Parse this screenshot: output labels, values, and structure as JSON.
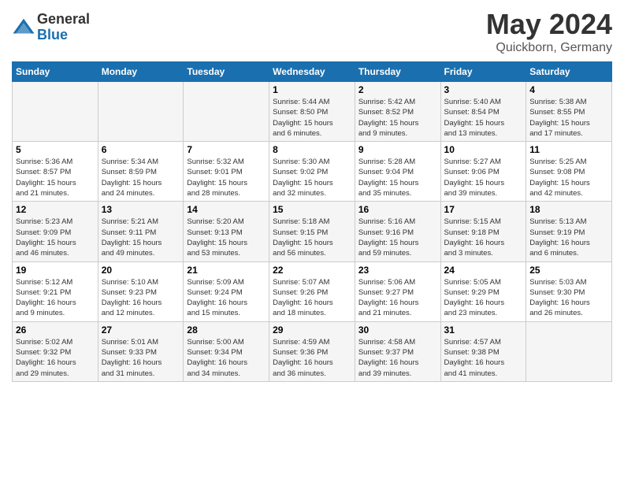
{
  "header": {
    "logo_general": "General",
    "logo_blue": "Blue",
    "month": "May 2024",
    "location": "Quickborn, Germany"
  },
  "weekdays": [
    "Sunday",
    "Monday",
    "Tuesday",
    "Wednesday",
    "Thursday",
    "Friday",
    "Saturday"
  ],
  "weeks": [
    [
      {
        "day": "",
        "info": ""
      },
      {
        "day": "",
        "info": ""
      },
      {
        "day": "",
        "info": ""
      },
      {
        "day": "1",
        "info": "Sunrise: 5:44 AM\nSunset: 8:50 PM\nDaylight: 15 hours\nand 6 minutes."
      },
      {
        "day": "2",
        "info": "Sunrise: 5:42 AM\nSunset: 8:52 PM\nDaylight: 15 hours\nand 9 minutes."
      },
      {
        "day": "3",
        "info": "Sunrise: 5:40 AM\nSunset: 8:54 PM\nDaylight: 15 hours\nand 13 minutes."
      },
      {
        "day": "4",
        "info": "Sunrise: 5:38 AM\nSunset: 8:55 PM\nDaylight: 15 hours\nand 17 minutes."
      }
    ],
    [
      {
        "day": "5",
        "info": "Sunrise: 5:36 AM\nSunset: 8:57 PM\nDaylight: 15 hours\nand 21 minutes."
      },
      {
        "day": "6",
        "info": "Sunrise: 5:34 AM\nSunset: 8:59 PM\nDaylight: 15 hours\nand 24 minutes."
      },
      {
        "day": "7",
        "info": "Sunrise: 5:32 AM\nSunset: 9:01 PM\nDaylight: 15 hours\nand 28 minutes."
      },
      {
        "day": "8",
        "info": "Sunrise: 5:30 AM\nSunset: 9:02 PM\nDaylight: 15 hours\nand 32 minutes."
      },
      {
        "day": "9",
        "info": "Sunrise: 5:28 AM\nSunset: 9:04 PM\nDaylight: 15 hours\nand 35 minutes."
      },
      {
        "day": "10",
        "info": "Sunrise: 5:27 AM\nSunset: 9:06 PM\nDaylight: 15 hours\nand 39 minutes."
      },
      {
        "day": "11",
        "info": "Sunrise: 5:25 AM\nSunset: 9:08 PM\nDaylight: 15 hours\nand 42 minutes."
      }
    ],
    [
      {
        "day": "12",
        "info": "Sunrise: 5:23 AM\nSunset: 9:09 PM\nDaylight: 15 hours\nand 46 minutes."
      },
      {
        "day": "13",
        "info": "Sunrise: 5:21 AM\nSunset: 9:11 PM\nDaylight: 15 hours\nand 49 minutes."
      },
      {
        "day": "14",
        "info": "Sunrise: 5:20 AM\nSunset: 9:13 PM\nDaylight: 15 hours\nand 53 minutes."
      },
      {
        "day": "15",
        "info": "Sunrise: 5:18 AM\nSunset: 9:15 PM\nDaylight: 15 hours\nand 56 minutes."
      },
      {
        "day": "16",
        "info": "Sunrise: 5:16 AM\nSunset: 9:16 PM\nDaylight: 15 hours\nand 59 minutes."
      },
      {
        "day": "17",
        "info": "Sunrise: 5:15 AM\nSunset: 9:18 PM\nDaylight: 16 hours\nand 3 minutes."
      },
      {
        "day": "18",
        "info": "Sunrise: 5:13 AM\nSunset: 9:19 PM\nDaylight: 16 hours\nand 6 minutes."
      }
    ],
    [
      {
        "day": "19",
        "info": "Sunrise: 5:12 AM\nSunset: 9:21 PM\nDaylight: 16 hours\nand 9 minutes."
      },
      {
        "day": "20",
        "info": "Sunrise: 5:10 AM\nSunset: 9:23 PM\nDaylight: 16 hours\nand 12 minutes."
      },
      {
        "day": "21",
        "info": "Sunrise: 5:09 AM\nSunset: 9:24 PM\nDaylight: 16 hours\nand 15 minutes."
      },
      {
        "day": "22",
        "info": "Sunrise: 5:07 AM\nSunset: 9:26 PM\nDaylight: 16 hours\nand 18 minutes."
      },
      {
        "day": "23",
        "info": "Sunrise: 5:06 AM\nSunset: 9:27 PM\nDaylight: 16 hours\nand 21 minutes."
      },
      {
        "day": "24",
        "info": "Sunrise: 5:05 AM\nSunset: 9:29 PM\nDaylight: 16 hours\nand 23 minutes."
      },
      {
        "day": "25",
        "info": "Sunrise: 5:03 AM\nSunset: 9:30 PM\nDaylight: 16 hours\nand 26 minutes."
      }
    ],
    [
      {
        "day": "26",
        "info": "Sunrise: 5:02 AM\nSunset: 9:32 PM\nDaylight: 16 hours\nand 29 minutes."
      },
      {
        "day": "27",
        "info": "Sunrise: 5:01 AM\nSunset: 9:33 PM\nDaylight: 16 hours\nand 31 minutes."
      },
      {
        "day": "28",
        "info": "Sunrise: 5:00 AM\nSunset: 9:34 PM\nDaylight: 16 hours\nand 34 minutes."
      },
      {
        "day": "29",
        "info": "Sunrise: 4:59 AM\nSunset: 9:36 PM\nDaylight: 16 hours\nand 36 minutes."
      },
      {
        "day": "30",
        "info": "Sunrise: 4:58 AM\nSunset: 9:37 PM\nDaylight: 16 hours\nand 39 minutes."
      },
      {
        "day": "31",
        "info": "Sunrise: 4:57 AM\nSunset: 9:38 PM\nDaylight: 16 hours\nand 41 minutes."
      },
      {
        "day": "",
        "info": ""
      }
    ]
  ]
}
